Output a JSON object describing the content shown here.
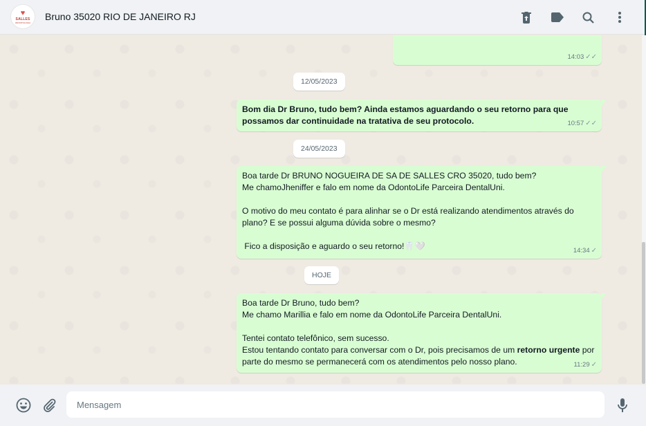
{
  "header": {
    "contact_name": "Bruno 35020 RIO DE JANEIRO RJ",
    "avatar_text": "SALLES",
    "avatar_sub": "ODONTOLOGIA",
    "actions": [
      "trash-icon",
      "label-icon",
      "search-icon",
      "menu-icon"
    ]
  },
  "chat": {
    "partial_message": {
      "time": "14:03",
      "ticks": "✓✓"
    },
    "messages": [
      {
        "date": "12/05/2023"
      },
      {
        "text": "Bom dia Dr Bruno, tudo bem? Ainda estamos aguardando o seu retorno para que possamos dar continuidade na tratativa de seu protocolo.",
        "time": "10:57",
        "ticks": "✓✓"
      },
      {
        "date": "24/05/2023"
      },
      {
        "text": "Boa tarde Dr BRUNO NOGUEIRA DE SA DE SALLES CRO 35020, tudo bem?\nMe chamoJheniffer e falo em nome da OdontoLife Parceira DentalUni.\n\nO motivo do meu contato é para alinhar se o Dr está realizando atendimentos através do plano? E se possui alguma dúvida sobre o mesmo?\n\n Fico a disposição e aguardo o seu retorno!🦷🤍",
        "time": "14:34",
        "ticks": "✓"
      },
      {
        "date": "HOJE"
      },
      {
        "text_before": "Boa tarde Dr Bruno, tudo bem?\nMe chamo Marillia e falo em nome da OdontoLife Parceira DentalUni.\n\nTentei contato telefônico, sem sucesso.\nEstou tentando contato para conversar com o Dr, pois precisamos de um ",
        "text_bold": "retorno urgente",
        "text_after": " por parte do mesmo se permanecerá com os atendimentos pelo nosso plano.",
        "time": "11:29",
        "ticks": "✓"
      }
    ]
  },
  "footer": {
    "input_placeholder": "Mensagem",
    "icons": [
      "emoji-icon",
      "attach-icon",
      "mic-icon"
    ]
  },
  "colors": {
    "outgoing_bubble": "#d9fdd3",
    "chat_background": "#efeae2",
    "header_background": "#f0f2f5"
  }
}
